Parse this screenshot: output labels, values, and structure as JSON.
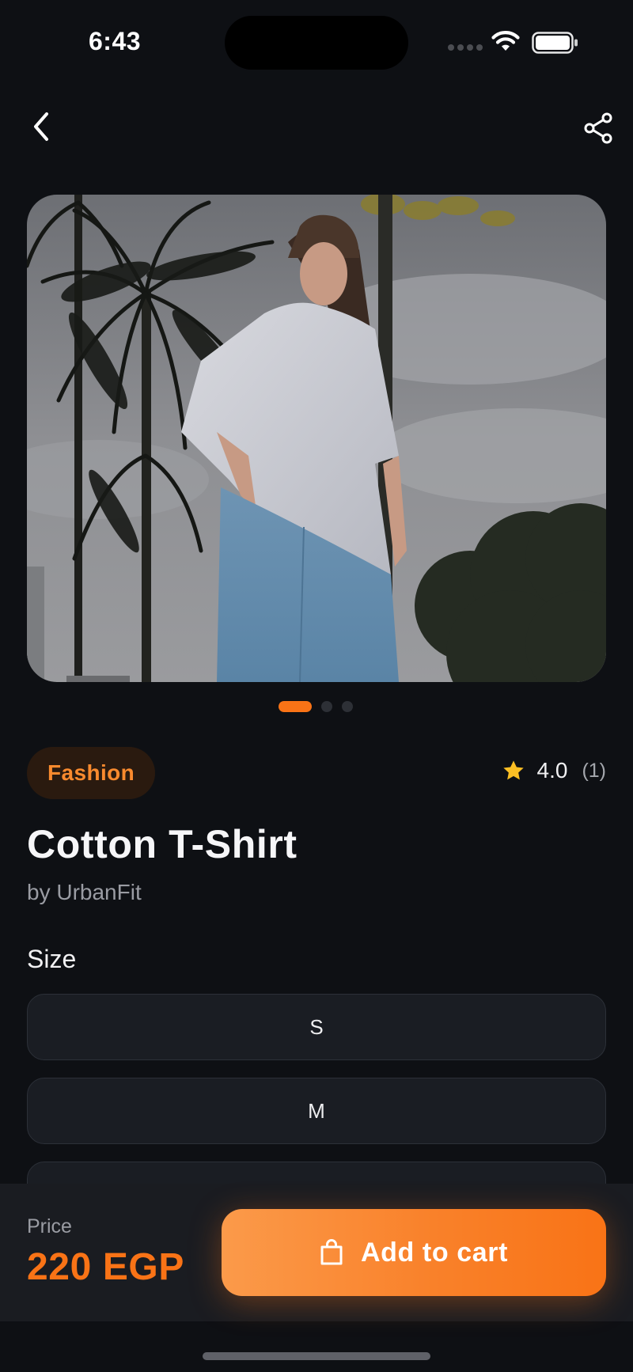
{
  "status_bar": {
    "time": "6:43"
  },
  "nav": {
    "back_icon": "chevron-left-icon",
    "share_icon": "share-icon"
  },
  "gallery": {
    "image_alt": "Model wearing white cotton t-shirt and blue jeans with palm trees",
    "pages": 3,
    "active_page": 1
  },
  "product": {
    "category": "Fashion",
    "rating": "4.0",
    "rating_count": "(1)",
    "title": "Cotton T-Shirt",
    "brand": "by UrbanFit"
  },
  "size": {
    "heading": "Size",
    "options": [
      "S",
      "M"
    ]
  },
  "checkout": {
    "price_label": "Price",
    "price": "220 EGP",
    "add_to_cart": "Add to cart"
  },
  "colors": {
    "accent": "#f97316",
    "background": "#0e1014",
    "surface": "#1a1d23",
    "star": "#fbbf24"
  }
}
